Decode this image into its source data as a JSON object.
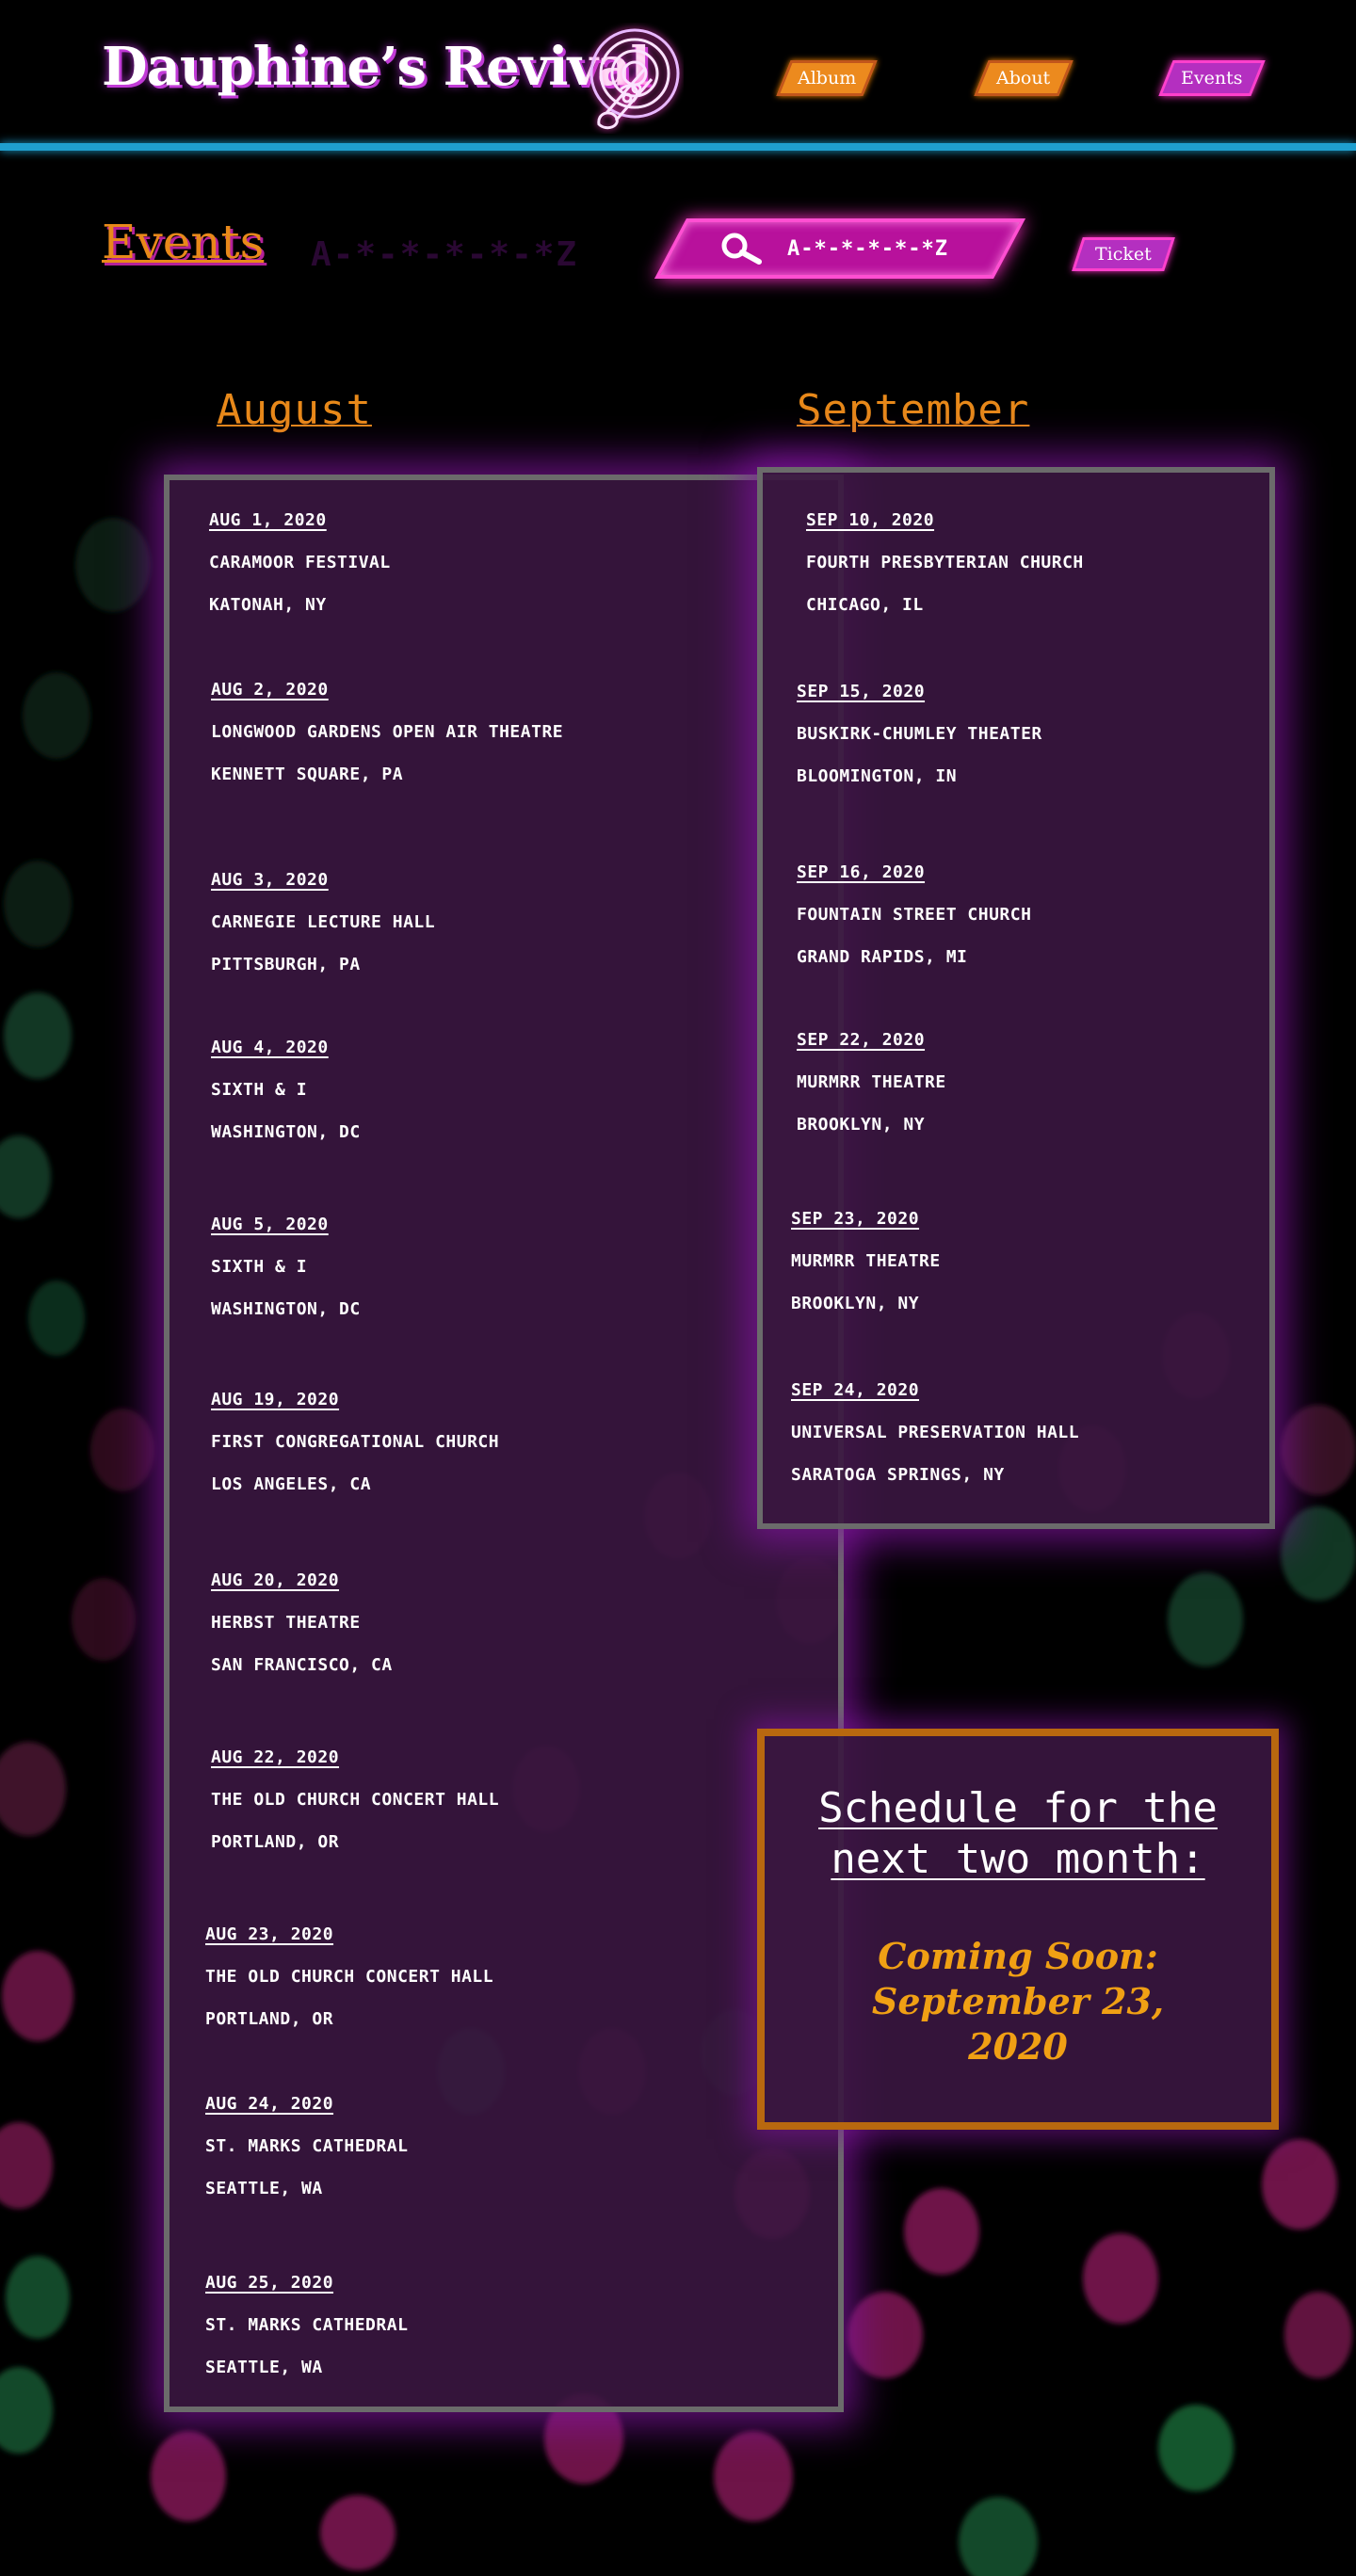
{
  "header": {
    "brand": "Dauphine’s Revival",
    "logo_icon": "neon-trumpet-logo-icon",
    "nav": [
      {
        "label": "Album"
      },
      {
        "label": "About"
      },
      {
        "label": "Events"
      }
    ]
  },
  "page": {
    "title": "Events",
    "title_ghost": "A-*-*-*-*-*Z",
    "search": {
      "icon": "search-icon",
      "value": "A-*-*-*-*-*Z"
    },
    "ticket_label": "Ticket"
  },
  "months": {
    "august": {
      "label": "August",
      "events": [
        {
          "date": "AUG 1, 2020",
          "venue": "CARAMOOR FESTIVAL",
          "city": "KATONAH, NY"
        },
        {
          "date": "AUG 2, 2020",
          "venue": "LONGWOOD GARDENS OPEN AIR THEATRE",
          "city": "KENNETT SQUARE, PA"
        },
        {
          "date": "AUG 3, 2020",
          "venue": "CARNEGIE LECTURE HALL",
          "city": "PITTSBURGH, PA"
        },
        {
          "date": "AUG 4, 2020",
          "venue": "SIXTH & I",
          "city": "WASHINGTON, DC"
        },
        {
          "date": "AUG 5, 2020",
          "venue": "SIXTH & I",
          "city": "WASHINGTON, DC"
        },
        {
          "date": "AUG 19, 2020",
          "venue": "FIRST CONGREGATIONAL CHURCH",
          "city": "LOS ANGELES, CA"
        },
        {
          "date": "AUG 20, 2020",
          "venue": "HERBST THEATRE",
          "city": "SAN FRANCISCO, CA"
        },
        {
          "date": "AUG 22, 2020",
          "venue": "THE OLD CHURCH CONCERT HALL",
          "city": "PORTLAND, OR"
        },
        {
          "date": "AUG 23, 2020",
          "venue": "THE OLD CHURCH CONCERT HALL",
          "city": "PORTLAND, OR"
        },
        {
          "date": "AUG 24, 2020",
          "venue": "ST. MARKS CATHEDRAL",
          "city": "SEATTLE, WA"
        },
        {
          "date": "AUG 25, 2020",
          "venue": "ST. MARKS CATHEDRAL",
          "city": "SEATTLE, WA"
        }
      ]
    },
    "september": {
      "label": "September",
      "events": [
        {
          "date": "SEP 10, 2020",
          "venue": "FOURTH PRESBYTERIAN CHURCH",
          "city": "CHICAGO, IL"
        },
        {
          "date": "SEP 15, 2020",
          "venue": "BUSKIRK-CHUMLEY THEATER",
          "city": "BLOOMINGTON, IN"
        },
        {
          "date": "SEP 16, 2020",
          "venue": "FOUNTAIN STREET CHURCH",
          "city": "GRAND RAPIDS, MI"
        },
        {
          "date": "SEP 22, 2020",
          "venue": "MURMRR THEATRE",
          "city": "BROOKLYN, NY"
        },
        {
          "date": "SEP 23, 2020",
          "venue": "MURMRR THEATRE",
          "city": "BROOKLYN, NY"
        },
        {
          "date": "SEP 24, 2020",
          "venue": "UNIVERSAL PRESERVATION HALL",
          "city": "SARATOGA SPRINGS, NY"
        }
      ]
    }
  },
  "schedule": {
    "title_line1": "Schedule for the",
    "title_line2": "next two month:",
    "coming_soon_line1": "Coming Soon:",
    "coming_soon_line2": "September 23,",
    "coming_soon_line3": "2020"
  },
  "colors": {
    "accent_orange": "#e8891a",
    "neon_pink": "#ff40cc",
    "header_line_blue": "#1f9fcf",
    "panel_bg": "#3a1640"
  }
}
